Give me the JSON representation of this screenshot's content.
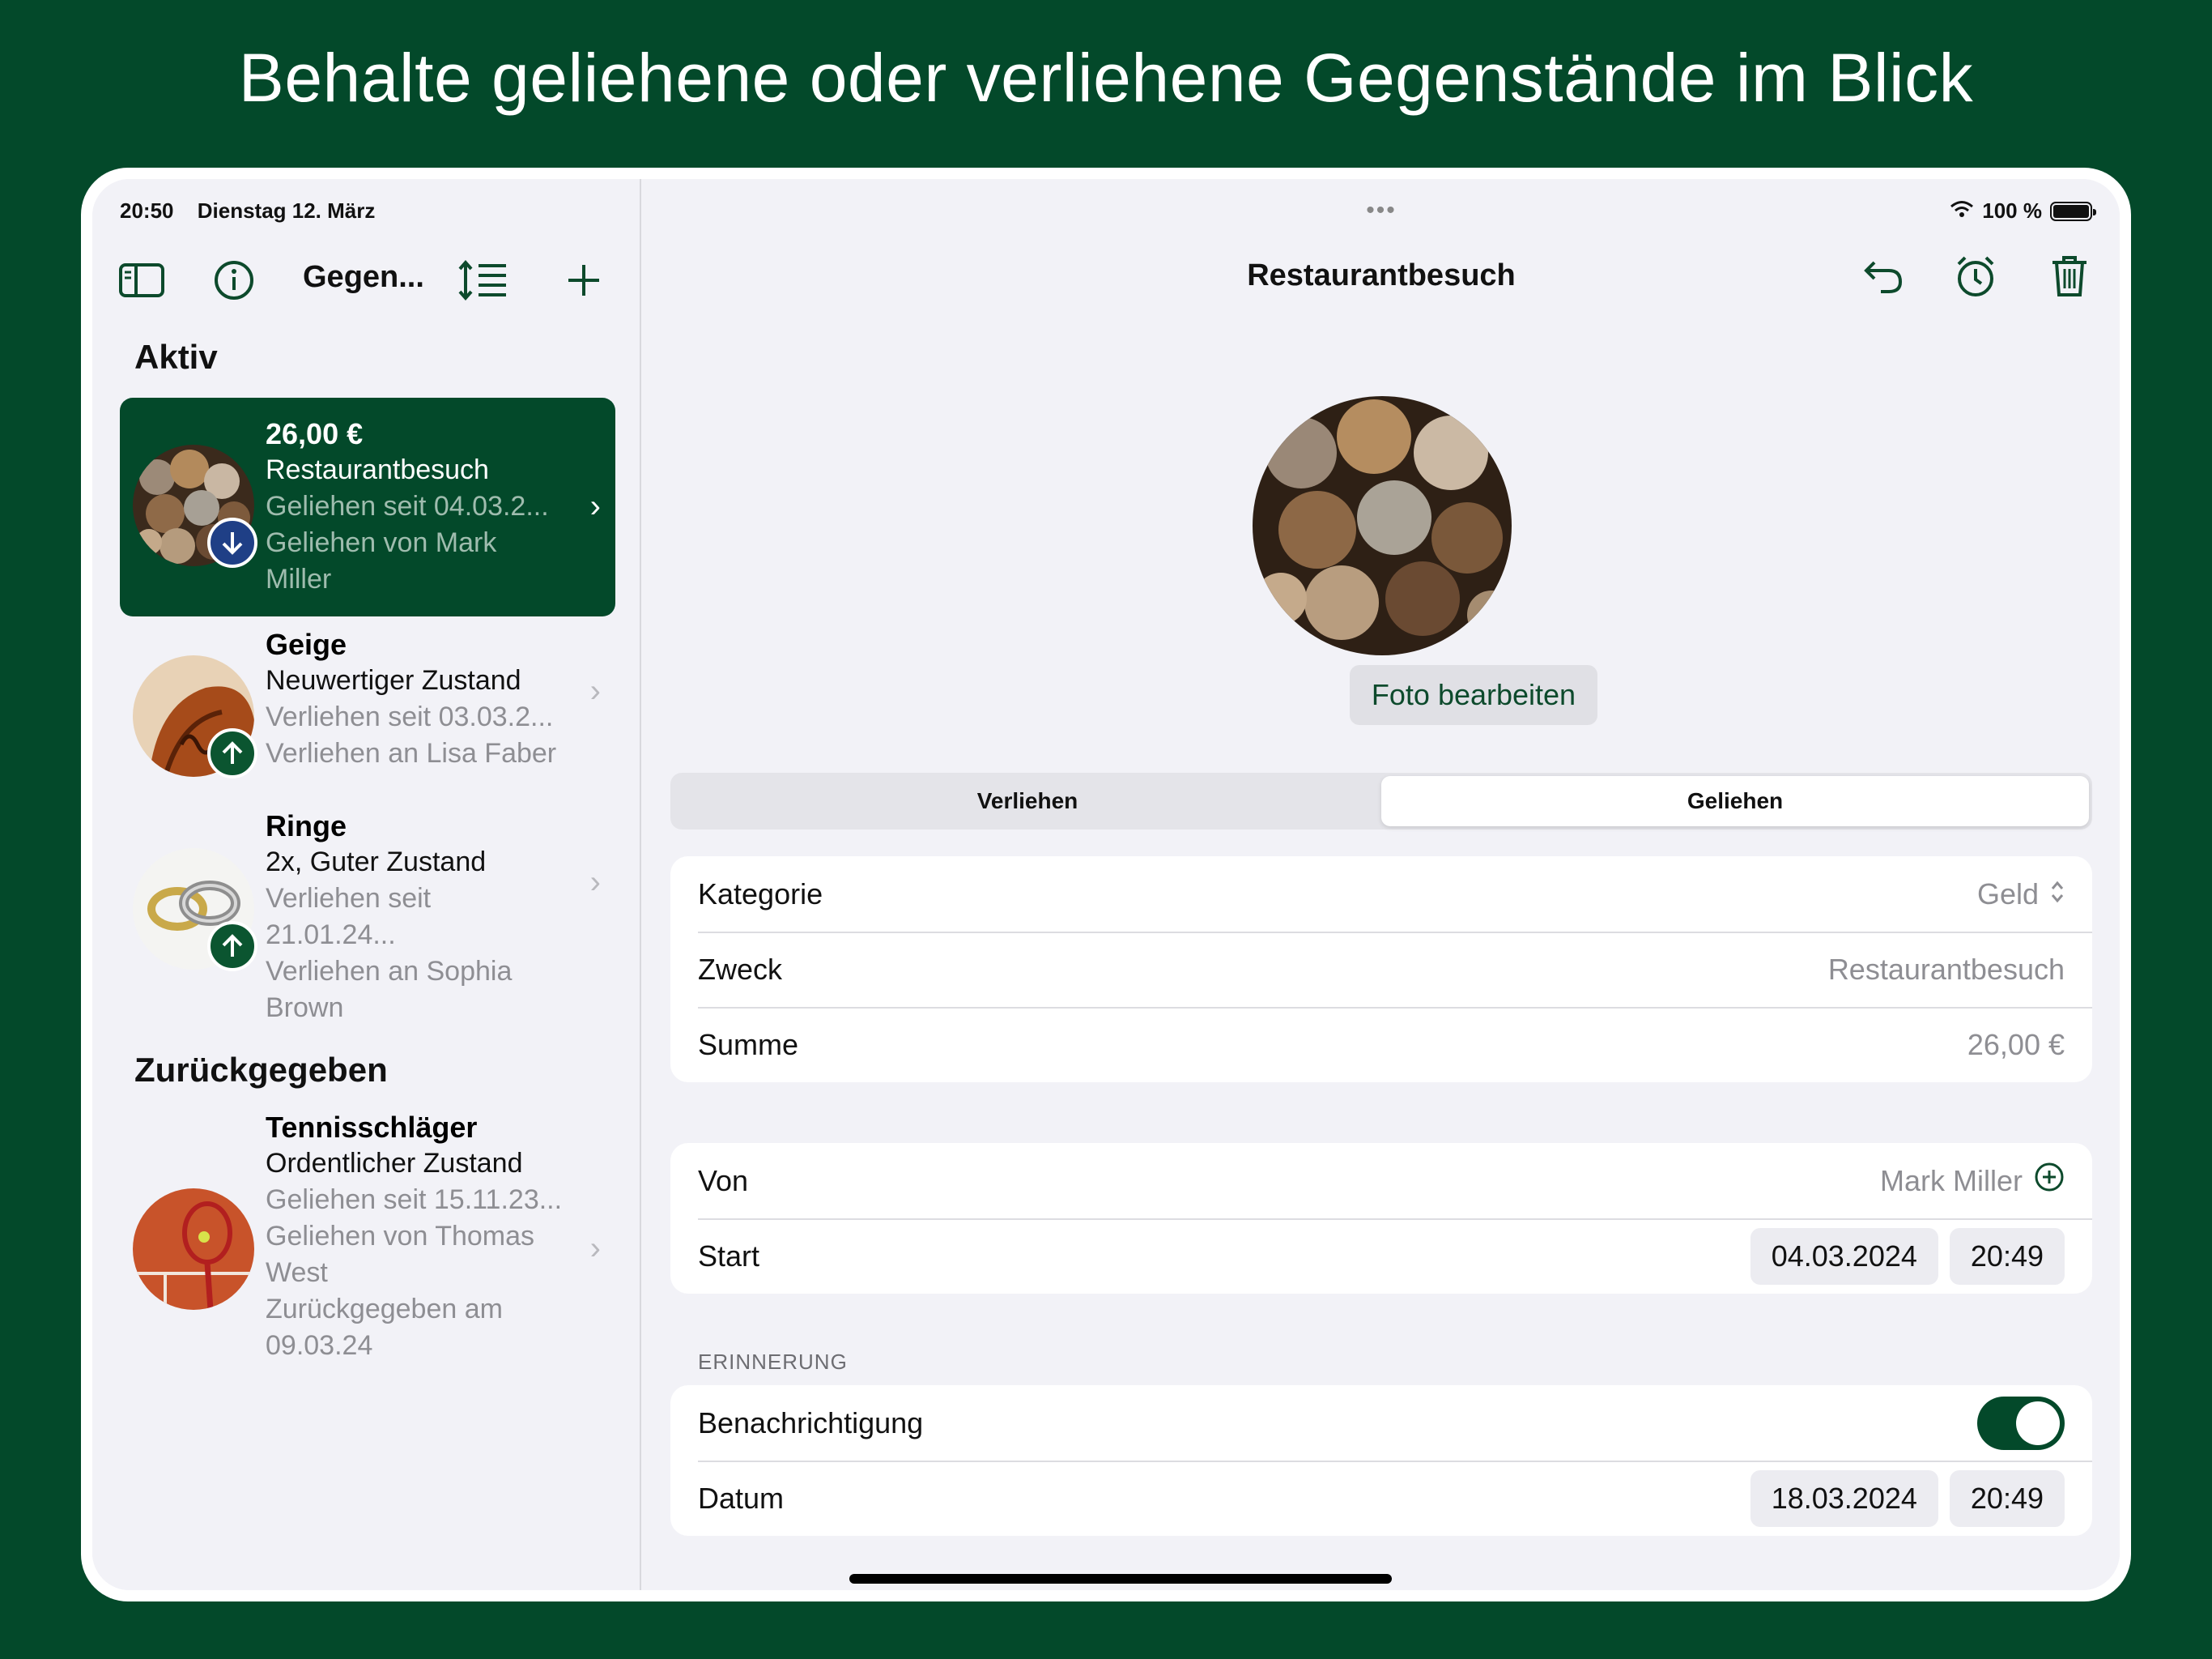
{
  "headline": "Behalte geliehene oder verliehene Gegenstände im Blick",
  "status": {
    "time": "20:50",
    "date": "Dienstag 12. März",
    "battery": "100 %"
  },
  "sidebar": {
    "title": "Gegen...",
    "section_active": "Aktiv",
    "section_returned": "Zurückgegeben",
    "items": [
      {
        "title": "26,00 €",
        "subtitle": "Restaurantbesuch",
        "line3": "Geliehen seit 04.03.2...",
        "line4": "Geliehen von Mark",
        "line5": "Miller",
        "direction": "in",
        "selected": true
      },
      {
        "title": "Geige",
        "subtitle": "Neuwertiger Zustand",
        "line3": "Verliehen seit 03.03.2...",
        "line4": "Verliehen an Lisa Faber",
        "direction": "out",
        "selected": false
      },
      {
        "title": "Ringe",
        "subtitle": "2x, Guter Zustand",
        "line3": "Verliehen seit 21.01.24...",
        "line4": "Verliehen an Sophia",
        "line5": "Brown",
        "direction": "out",
        "selected": false
      },
      {
        "title": "Tennisschläger",
        "subtitle": "Ordentlicher Zustand",
        "line3": "Geliehen seit 15.11.23...",
        "line4": "Geliehen von Thomas",
        "line5": "West",
        "line6": "Zurückgegeben am",
        "line7": "09.03.24",
        "direction": "none",
        "selected": false
      }
    ]
  },
  "detail": {
    "title": "Restaurantbesuch",
    "photo_button": "Foto bearbeiten",
    "segments": [
      "Verliehen",
      "Geliehen"
    ],
    "active_segment": "Geliehen",
    "fields1": [
      {
        "label": "Kategorie",
        "value": "Geld"
      },
      {
        "label": "Zweck",
        "value": "Restaurantbesuch"
      },
      {
        "label": "Summe",
        "value": "26,00 €"
      }
    ],
    "von": {
      "label": "Von",
      "value": "Mark Miller"
    },
    "start": {
      "label": "Start",
      "date": "04.03.2024",
      "time": "20:49"
    },
    "reminder_caption": "ERINNERUNG",
    "notification": {
      "label": "Benachrichtigung",
      "enabled": true
    },
    "datum": {
      "label": "Datum",
      "date": "18.03.2024",
      "time": "20:49"
    }
  },
  "icons": {
    "sidebar_toggle": "sidebar-icon",
    "info": "info-icon",
    "sort": "sort-icon",
    "add": "plus-icon",
    "undo": "return-icon",
    "alarm": "alarm-icon",
    "trash": "trash-icon"
  },
  "colors": {
    "accent": "#03492a",
    "background": "#03492a",
    "badge_in": "#1f3f86",
    "badge_out": "#0b5530"
  }
}
